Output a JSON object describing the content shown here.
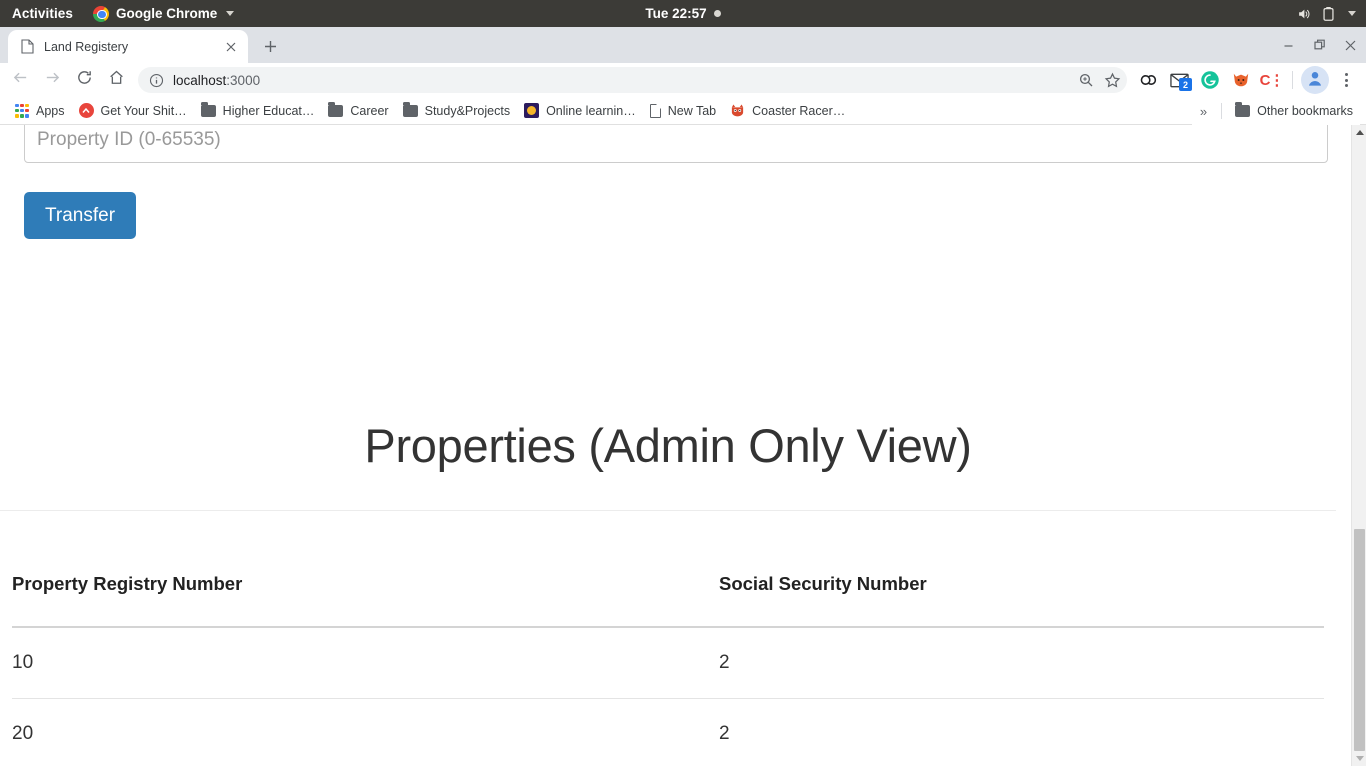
{
  "os_bar": {
    "activities": "Activities",
    "app_name": "Google Chrome",
    "clock": "Tue 22:57",
    "chrome_icon": "chrome-logo-icon",
    "app_caret_icon": "chevron-down-icon",
    "recording_dot_icon": "recording-indicator-icon",
    "volume_icon": "volume-icon",
    "battery_icon": "battery-icon",
    "system_menu_caret_icon": "chevron-down-icon"
  },
  "browser": {
    "tab": {
      "title": "Land Registery",
      "favicon_icon": "page-document-icon",
      "close_icon": "close-icon"
    },
    "new_tab_icon": "plus-icon",
    "window_controls": {
      "minimize_icon": "minimize-icon",
      "maximize_icon": "restore-window-icon",
      "close_icon": "close-icon"
    },
    "toolbar": {
      "back_icon": "arrow-left-icon",
      "forward_icon": "arrow-right-icon",
      "reload_icon": "reload-icon",
      "home_icon": "home-icon",
      "site_info_icon": "info-circle-icon",
      "url_host": "localhost",
      "url_port": ":3000",
      "zoom_icon": "zoom-magnifier-icon",
      "bookmark_star_icon": "star-icon",
      "extensions": [
        {
          "name": "loop-extension-icon",
          "color": "#202124",
          "badge": ""
        },
        {
          "name": "mail-extension-icon",
          "color": "#3c4043",
          "badge": "2"
        },
        {
          "name": "grammarly-extension-icon",
          "color": "#15c39a",
          "badge": ""
        },
        {
          "name": "fox-extension-icon",
          "color": "#e8622c",
          "badge": ""
        },
        {
          "name": "colon-c-extension-icon",
          "color": "#e8453c",
          "badge": ""
        }
      ],
      "profile_avatar_icon": "user-avatar-icon",
      "menu_icon": "three-dot-menu-icon"
    },
    "bookmarks": {
      "items": [
        {
          "label": "Apps",
          "icon": "apps-grid-icon"
        },
        {
          "label": "Get Your Shit…",
          "icon": "red-circle-favicon"
        },
        {
          "label": "Higher Educat…",
          "icon": "folder-icon"
        },
        {
          "label": "Career",
          "icon": "folder-icon"
        },
        {
          "label": "Study&Projects",
          "icon": "folder-icon"
        },
        {
          "label": "Online learnin…",
          "icon": "purple-square-favicon"
        },
        {
          "label": "New Tab",
          "icon": "page-document-icon"
        },
        {
          "label": "Coaster Racer…",
          "icon": "red-monster-favicon"
        }
      ],
      "overflow_icon": "double-chevron-right-icon",
      "overflow_label": "»",
      "other_bookmarks_label": "Other bookmarks",
      "other_bookmarks_icon": "folder-icon"
    }
  },
  "page": {
    "property_id_input": {
      "value": "",
      "placeholder": "Property ID (0-65535)"
    },
    "transfer_button_label": "Transfer",
    "section_title": "Properties (Admin Only View)",
    "table": {
      "columns": [
        "Property Registry Number",
        "Social Security Number"
      ],
      "rows": [
        {
          "registry_number": "10",
          "ssn": "2"
        },
        {
          "registry_number": "20",
          "ssn": "2"
        }
      ]
    },
    "colors": {
      "button_blue": "#2f7cb8",
      "heading_gray": "#333333",
      "border_gray": "#cccccc"
    }
  },
  "scrollbar": {
    "up_arrow_icon": "triangle-up-icon",
    "down_arrow_icon": "triangle-down-icon",
    "thumb": "scroll-thumb"
  }
}
